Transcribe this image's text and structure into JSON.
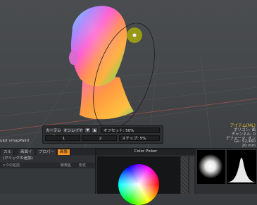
{
  "viewport": {
    "info_lines": [
      "アイテム(ML)",
      "ポリゴン: 面",
      "チャンネル: 0",
      "デフォーマ: オン",
      "GL: 52,460",
      "20 mm"
    ],
    "layer_label": "ulpt vmapPaint"
  },
  "tool_panel": {
    "mode_left": "カーテレメ",
    "mode_right": "オンレイヤー",
    "offset_label": "オフセット: 50%",
    "step_label": "ステップ: 5%",
    "value_1": "1",
    "value_2": "2"
  },
  "bottom": {
    "tabs": [
      "スル",
      "画面イ",
      "プロパー",
      "画像"
    ],
    "active_tab": 3,
    "layer_filter": "(クリックの追加)",
    "layer_columns": [
      "ックの名前",
      "新規名",
      "形式"
    ],
    "color_picker_title": "Color Picker"
  },
  "colors": {
    "accent": "#f4931f",
    "info_title": "#e8c030",
    "background": "#3a3d40"
  }
}
